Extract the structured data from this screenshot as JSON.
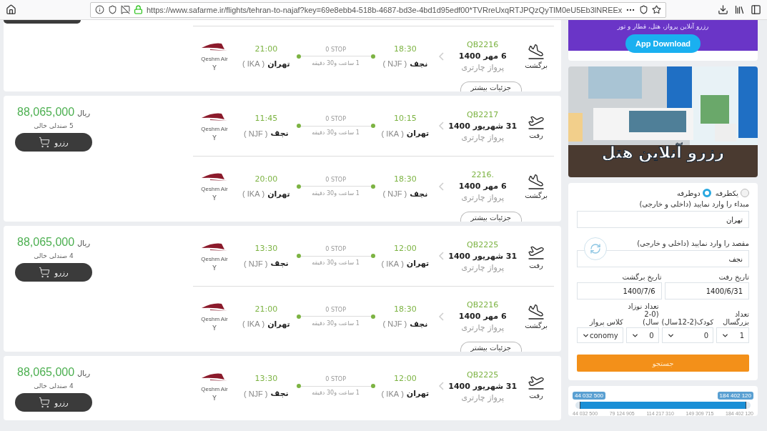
{
  "browser": {
    "url": "https://www.safarme.ir/flights/tehran-to-najaf?key=69e8ebb4-518b-4687-bd3e-4bd1d95edf00*TVRreUxqRTJPQzQyTlM0eU5Eb3lNREEx"
  },
  "results": [
    {
      "kind": "partial",
      "details": "جزئیات بیشتر",
      "legs": [
        {
          "kind": "return",
          "direction": "برگشت",
          "flight_no": "QB2216",
          "date": "6 مهر 1400",
          "flight_type": "پرواز چارتری",
          "dep_time": "18:30",
          "dep_city": "نجف",
          "dep_code": "( NJF )",
          "stops": "0 STOP",
          "duration": "1 ساعت و30 دقیقه",
          "arr_time": "21:00",
          "arr_city": "تهران",
          "arr_code": "( IKA )",
          "airline": "Qeshm Air",
          "cabin": "Y"
        }
      ]
    },
    {
      "kind": "full",
      "price": "88,065,000",
      "currency": "ریال",
      "seats": "5 صندلی خالی",
      "button": "رزرو",
      "details": "جزئیات بیشتر",
      "legs": [
        {
          "kind": "outbound",
          "direction": "رفت",
          "flight_no": "QB2217",
          "date": "31 شهریور 1400",
          "flight_type": "پرواز چارتری",
          "dep_time": "10:15",
          "dep_city": "تهران",
          "dep_code": "( IKA )",
          "stops": "0 STOP",
          "duration": "1 ساعت و30 دقیقه",
          "arr_time": "11:45",
          "arr_city": "نجف",
          "arr_code": "( NJF )",
          "airline": "Qeshm Air",
          "cabin": "Y"
        },
        {
          "kind": "return",
          "direction": "برگشت",
          "flight_no": ".2216",
          "date": "6 مهر 1400",
          "flight_type": "پرواز چارتری",
          "dep_time": "18:30",
          "dep_city": "نجف",
          "dep_code": "( NJF )",
          "stops": "0 STOP",
          "duration": "1 ساعت و30 دقیقه",
          "arr_time": "20:00",
          "arr_city": "تهران",
          "arr_code": "( IKA )",
          "airline": "Qeshm Air",
          "cabin": "Y"
        }
      ]
    },
    {
      "kind": "full",
      "price": "88,065,000",
      "currency": "ریال",
      "seats": "4 صندلی خالی",
      "button": "رزرو",
      "details": "جزئیات بیشتر",
      "legs": [
        {
          "kind": "outbound",
          "direction": "رفت",
          "flight_no": "QB2225",
          "date": "31 شهریور 1400",
          "flight_type": "پرواز چارتری",
          "dep_time": "12:00",
          "dep_city": "تهران",
          "dep_code": "( IKA )",
          "stops": "0 STOP",
          "duration": "1 ساعت و30 دقیقه",
          "arr_time": "13:30",
          "arr_city": "نجف",
          "arr_code": "( NJF )",
          "airline": "Qeshm Air",
          "cabin": "Y"
        },
        {
          "kind": "return",
          "direction": "برگشت",
          "flight_no": "QB2216",
          "date": "6 مهر 1400",
          "flight_type": "پرواز چارتری",
          "dep_time": "18:30",
          "dep_city": "نجف",
          "dep_code": "( NJF )",
          "stops": "0 STOP",
          "duration": "1 ساعت و30 دقیقه",
          "arr_time": "21:00",
          "arr_city": "تهران",
          "arr_code": "( IKA )",
          "airline": "Qeshm Air",
          "cabin": "Y"
        }
      ]
    },
    {
      "kind": "full",
      "price": "88,065,000",
      "currency": "ریال",
      "seats": "4 صندلی خالی",
      "button": "رزرو",
      "legs": [
        {
          "kind": "outbound",
          "direction": "رفت",
          "flight_no": "QB2225",
          "date": "31 شهریور 1400",
          "flight_type": "پرواز چارتری",
          "dep_time": "12:00",
          "dep_city": "تهران",
          "dep_code": "( IKA )",
          "stops": "0 STOP",
          "duration": "1 ساعت و30 دقیقه",
          "arr_time": "13:30",
          "arr_city": "نجف",
          "arr_code": "( NJF )",
          "airline": "Qeshm Air",
          "cabin": "Y"
        }
      ]
    }
  ],
  "sidebar": {
    "app_banner": {
      "text": "رزرو آنلاین پرواز، هتل، قطار و تور",
      "button": "App Download"
    },
    "hotel_banner": {
      "kind": "picture",
      "title": "رزرو آنلاین هتل"
    },
    "search": {
      "trip_types": [
        {
          "label": "یکطرفه",
          "selected": false
        },
        {
          "label": "دوطرفه",
          "selected": true
        }
      ],
      "origin": {
        "label": "مبداء را وارد نمایید (داخلی و خارجی)",
        "value": "تهران"
      },
      "destination": {
        "label": "مقصد را وارد نمایید (داخلی و خارجی)",
        "value": "نجف"
      },
      "dates": [
        {
          "label": "تاریخ رفت",
          "value": "1400/6/31"
        },
        {
          "label": "تاریخ برگشت",
          "value": "1400/7/6"
        }
      ],
      "passengers": [
        {
          "label": "تعداد بزرگسال",
          "value": "1"
        },
        {
          "label": "کودک(2-12سال)",
          "value": "0"
        },
        {
          "label": "تعداد نوزاد (0-2 سال)",
          "value": "0"
        },
        {
          "label": "کلاس پرواز",
          "value": "conomy"
        }
      ],
      "button": "جستجو"
    },
    "price_filter": {
      "min_label": "44 032 500",
      "max_label": "184 402 120",
      "level": 1,
      "ticks": [
        "184 402 120",
        "149 309 715",
        "114 217 310",
        "79 124 905",
        "44 032 500"
      ]
    }
  }
}
